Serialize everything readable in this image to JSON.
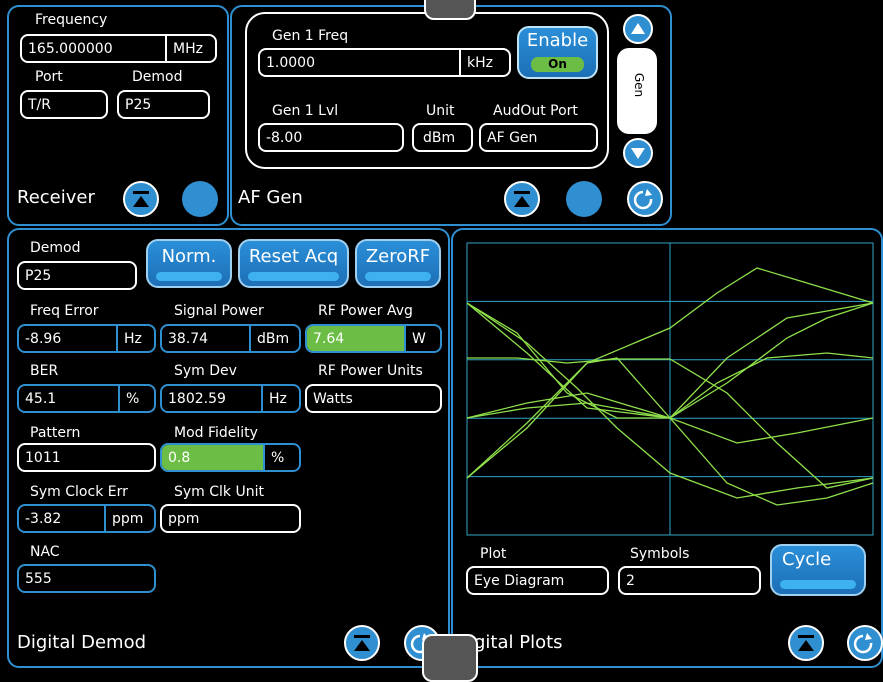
{
  "receiver": {
    "title": "Receiver",
    "frequency_label": "Frequency",
    "frequency_value": "165.000000",
    "frequency_unit": "MHz",
    "port_label": "Port",
    "port_value": "T/R",
    "demod_label": "Demod",
    "demod_value": "P25"
  },
  "af_gen": {
    "title": "AF Gen",
    "gen1_freq_label": "Gen 1 Freq",
    "gen1_freq_value": "1.0000",
    "gen1_freq_unit": "kHz",
    "enable_label": "Enable",
    "enable_state": "On",
    "gen1_lvl_label": "Gen 1 Lvl",
    "gen1_lvl_value": "-8.00",
    "unit_label": "Unit",
    "unit_value": "dBm",
    "audout_label": "AudOut Port",
    "audout_value": "AF Gen",
    "side_tab": "Gen"
  },
  "digital_demod": {
    "title": "Digital Demod",
    "demod_label": "Demod",
    "demod_value": "P25",
    "buttons": {
      "norm": "Norm.",
      "reset_acq": "Reset Acq",
      "zero_rf": "ZeroRF"
    },
    "freq_error_label": "Freq Error",
    "freq_error_value": "-8.96",
    "freq_error_unit": "Hz",
    "signal_power_label": "Signal Power",
    "signal_power_value": "38.74",
    "signal_power_unit": "dBm",
    "rf_power_avg_label": "RF Power Avg",
    "rf_power_avg_value": "7.64",
    "rf_power_avg_unit": "W",
    "ber_label": "BER",
    "ber_value": "45.1",
    "ber_unit": "%",
    "sym_dev_label": "Sym Dev",
    "sym_dev_value": "1802.59",
    "sym_dev_unit": "Hz",
    "rf_power_units_label": "RF Power Units",
    "rf_power_units_value": "Watts",
    "pattern_label": "Pattern",
    "pattern_value": "1011",
    "mod_fidelity_label": "Mod Fidelity",
    "mod_fidelity_value": "0.8",
    "mod_fidelity_unit": "%",
    "sym_clock_err_label": "Sym Clock Err",
    "sym_clock_err_value": "-3.82",
    "sym_clock_err_unit": "ppm",
    "sym_clk_unit_label": "Sym Clk Unit",
    "sym_clk_unit_value": "ppm",
    "nac_label": "NAC",
    "nac_value": "555"
  },
  "digital_plots": {
    "title": "igital Plots",
    "plot_label": "Plot",
    "plot_value": "Eye Diagram",
    "symbols_label": "Symbols",
    "symbols_value": "2",
    "cycle_label": "Cycle"
  },
  "colors": {
    "accent": "#2f8fd0",
    "green": "#6cbd45",
    "trace": "#8fe04a",
    "grid": "#2fa6c8"
  },
  "icons": [
    "collapse-icon",
    "circle-button-icon",
    "rotate-icon",
    "scroll-up-icon",
    "scroll-down-icon"
  ]
}
